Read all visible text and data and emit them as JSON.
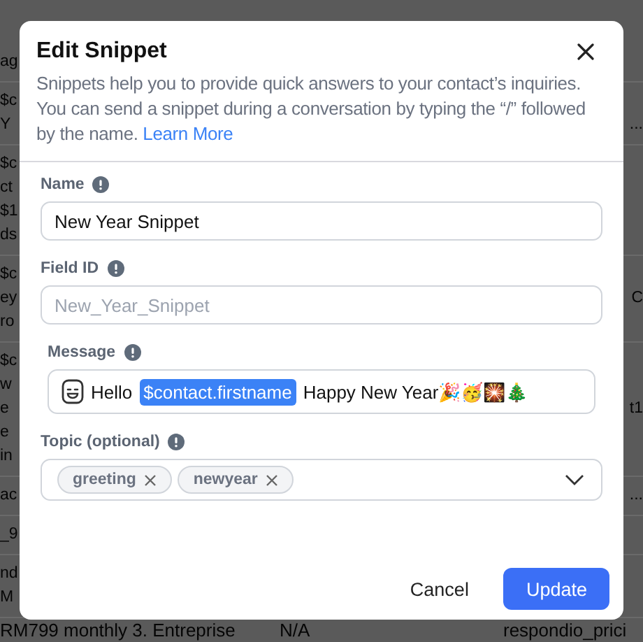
{
  "background_table": {
    "rows": [
      {
        "lines": [
          {
            "column_1": "ag"
          }
        ]
      },
      {
        "lines": [
          {
            "column_1": "$c"
          },
          {
            "column_1": "Y",
            "column_3": "..."
          }
        ]
      },
      {
        "lines": [
          {
            "column_1": "$c"
          },
          {
            "column_1": "ct"
          },
          {
            "column_1": "$1"
          },
          {
            "column_1": "ds"
          }
        ]
      },
      {
        "lines": [
          {
            "column_1": "$c"
          },
          {
            "column_1": "ey",
            "column_3": "C"
          },
          {
            "column_1": "ro"
          }
        ]
      },
      {
        "lines": [
          {
            "column_1": "$c"
          },
          {
            "column_1": "w"
          },
          {
            "column_1": "e",
            "column_3": "t1"
          },
          {
            "column_1": "e"
          },
          {
            "column_1": "in"
          }
        ]
      },
      {
        "lines": [
          {
            "column_1": "ac",
            "column_3": "..."
          }
        ]
      },
      {
        "lines": [
          {
            "column_1": "_9"
          }
        ]
      },
      {
        "lines": [
          {
            "column_1": "nd"
          },
          {
            "column_1": "M"
          }
        ]
      }
    ],
    "bottom_line": {
      "column_1": "RM799 monthly 3. Entreprise",
      "column_2": "N/A",
      "column_3": "respondio_prici"
    }
  },
  "dialog": {
    "title": "Edit Snippet",
    "description": "Snippets help you to provide quick answers to your contact’s inquiries. You can send a snippet during a conversation by typing the “/” followed by the name.",
    "description_link": "Learn More",
    "fields": [
      {
        "kind": "text",
        "label": "Name",
        "value": "New Year Snippet"
      },
      {
        "kind": "text",
        "label": "Field ID",
        "placeholder": "New_Year_Snippet"
      },
      {
        "kind": "message",
        "label": "Message",
        "parts": [
          {
            "kind": "text",
            "text": "Hello"
          },
          {
            "kind": "variable",
            "text": "$contact.firstname"
          },
          {
            "kind": "text",
            "text": "Happy New Year🎉🥳🎇🎄"
          }
        ]
      },
      {
        "kind": "tags",
        "label": "Topic (optional)",
        "tags": [
          "greeting",
          "newyear"
        ]
      }
    ],
    "buttons": [
      {
        "label": "Cancel",
        "primary": false
      },
      {
        "label": "Update",
        "primary": true
      }
    ]
  }
}
